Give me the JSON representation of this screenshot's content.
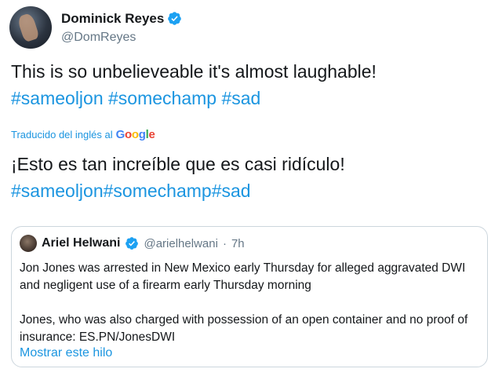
{
  "tweet": {
    "author": {
      "display_name": "Dominick Reyes",
      "handle": "@DomReyes",
      "verified": true
    },
    "text_line": "This is so unbelieveable it's almost laughable!",
    "hashtags": "#sameoljon #somechamp #sad",
    "translation": {
      "label": "Traducido del inglés al",
      "provider": "Google",
      "text_line": "¡Esto es tan increíble que es casi ridículo!",
      "hashtags": "#sameoljon#somechamp#sad"
    }
  },
  "quoted_tweet": {
    "display_name": "Ariel Helwani",
    "handle": "@arielhelwani",
    "separator": "·",
    "time": "7h",
    "paragraph_1": "Jon Jones was arrested in New Mexico early Thursday for alleged aggravated DWI and negligent use of a firearm early Thursday morning",
    "paragraph_2": "Jones, who was also charged with possession of an open container and no proof of insurance: ES.PN/JonesDWI",
    "show_thread_label": "Mostrar este hilo"
  },
  "colors": {
    "link_blue": "#1b95e0",
    "verified_blue": "#1da1f2",
    "muted_gray": "#657786",
    "border": "#ccd6dd"
  }
}
